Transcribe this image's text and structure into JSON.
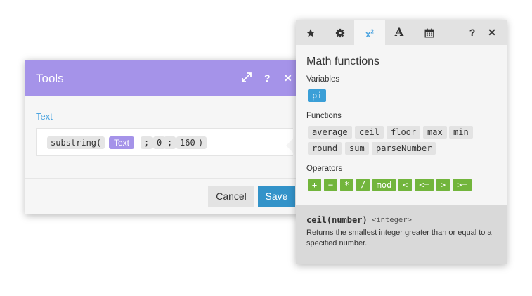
{
  "tools_dialog": {
    "title": "Tools",
    "field_label": "Text",
    "expression": {
      "fn_open": "substring(",
      "text_pill": "Text",
      "sep1": ";",
      "arg1": "0",
      "sep2": ";",
      "arg2": "160",
      "close": ")"
    },
    "cancel_label": "Cancel",
    "save_label": "Save",
    "header_icons": [
      "expand-icon",
      "help-icon",
      "close-icon"
    ],
    "header_help_glyph": "?",
    "header_close_glyph": "✕"
  },
  "math_panel": {
    "tabs": [
      {
        "name": "favorites",
        "icon": "star-icon"
      },
      {
        "name": "general",
        "icon": "gear-icon"
      },
      {
        "name": "math",
        "icon": "superscript-icon",
        "label": "x",
        "sup": "2",
        "active": true
      },
      {
        "name": "text",
        "icon": "font-icon",
        "label": "A"
      },
      {
        "name": "date",
        "icon": "calendar-icon"
      }
    ],
    "help_glyph": "?",
    "close_glyph": "✕",
    "title": "Math functions",
    "variables_label": "Variables",
    "variables": [
      "pi"
    ],
    "functions_label": "Functions",
    "functions": [
      "average",
      "ceil",
      "floor",
      "max",
      "min",
      "round",
      "sum",
      "parseNumber"
    ],
    "operators_label": "Operators",
    "operators": [
      "+",
      "−",
      "*",
      "/",
      "mod",
      "<",
      "<=",
      ">",
      ">="
    ],
    "detail": {
      "signature": "ceil(number)",
      "return_type": "<integer>",
      "description": "Returns the smallest integer greater than or equal to a specified number."
    }
  },
  "colors": {
    "tools_header": "#a593e9",
    "save_button": "#3393c9",
    "variable_chip": "#3b9fd7",
    "operator_chip": "#72b53c",
    "active_tab": "#4ba4e0"
  }
}
